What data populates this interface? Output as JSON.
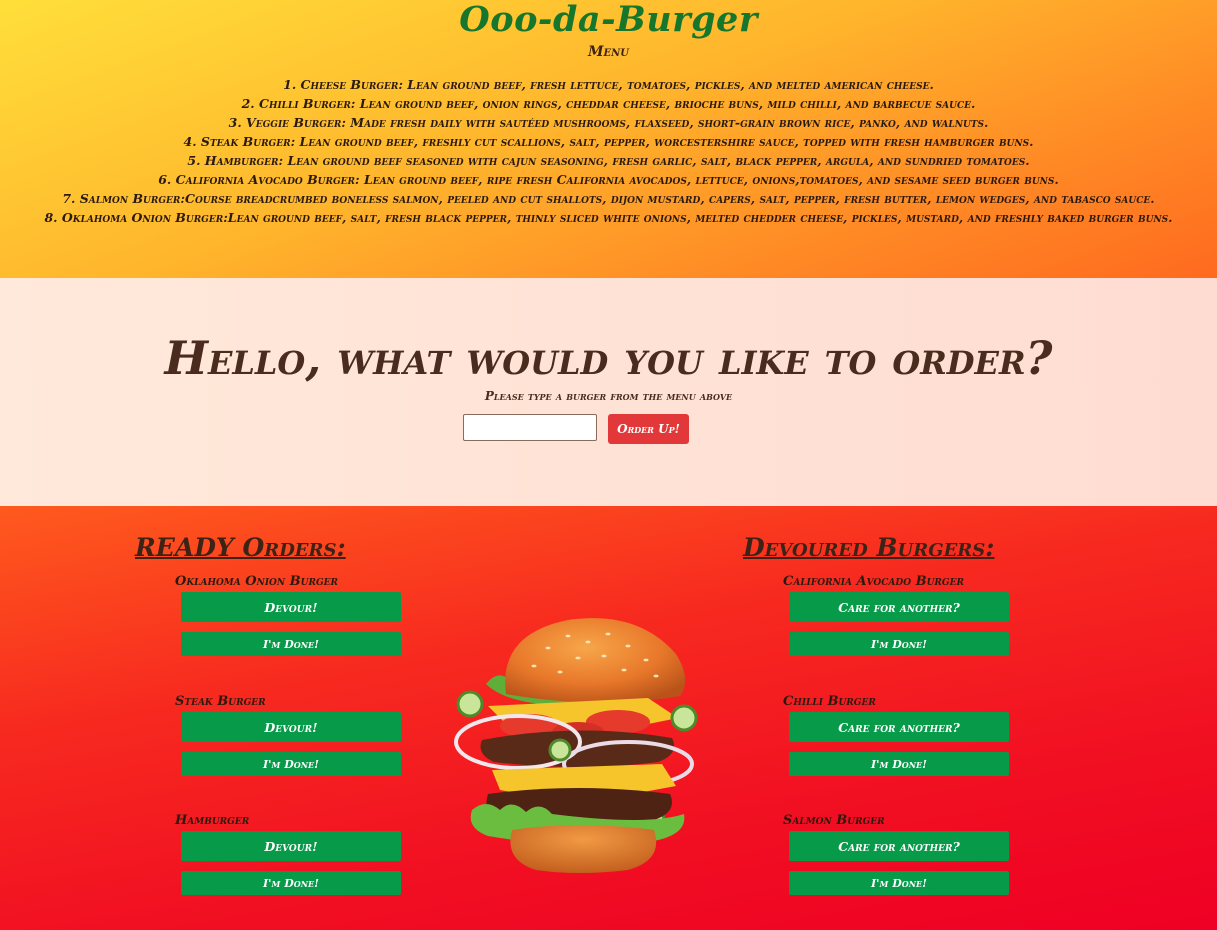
{
  "header": {
    "title": "Ooo-da-Burger",
    "menu_heading": "Menu",
    "menu_items": [
      "1. Cheese Burger: Lean ground beef, fresh lettuce, tomatoes, pickles, and melted american cheese.",
      "2. Chilli Burger: Lean ground beef, onion rings, cheddar cheese, brioche buns, mild chilli, and barbecue sauce.",
      "3. Veggie Burger: Made fresh daily with sautéed mushrooms, flaxseed, short-grain brown rice, panko, and walnuts.",
      "4. Steak Burger: Lean ground beef, freshly cut scallions, salt, pepper, worcestershire sauce, topped with fresh hamburger buns.",
      "5. Hamburger: Lean ground beef seasoned with cajun seasoning, fresh garlic, salt, black pepper, argula, and sundried tomatoes.",
      "6. California Avocado Burger: Lean ground beef, ripe fresh California avocados, lettuce, onions,tomatoes, and sesame seed burger buns.",
      "7. Salmon Burger:Course breadcrumbed boneless salmon, peeled and cut shallots, dijon mustard, capers, salt, pepper, fresh butter, lemon wedges, and tabasco sauce.",
      "8. Oklahoma Onion Burger:Lean ground beef, salt, fresh black pepper, thinly sliced white onions, melted chedder cheese, pickles, mustard, and freshly baked burger buns."
    ]
  },
  "order": {
    "question": "Hello, what would you like to order?",
    "hint": "Please type a burger from the menu above",
    "input_value": "",
    "button_label": "Order Up!"
  },
  "ready": {
    "heading": "READY Orders:",
    "items": [
      {
        "name": "Oklahoma Onion Burger",
        "primary": "Devour!",
        "secondary": "I'm Done!"
      },
      {
        "name": "Steak Burger",
        "primary": "Devour!",
        "secondary": "I'm Done!"
      },
      {
        "name": "Hamburger",
        "primary": "Devour!",
        "secondary": "I'm Done!"
      }
    ]
  },
  "devoured": {
    "heading": "Devoured Burgers:",
    "items": [
      {
        "name": "California Avocado Burger",
        "primary": "Care for another?",
        "secondary": "I'm Done!"
      },
      {
        "name": "Chilli Burger",
        "primary": "Care for another?",
        "secondary": "I'm Done!"
      },
      {
        "name": "Salmon Burger",
        "primary": "Care for another?",
        "secondary": "I'm Done!"
      }
    ]
  },
  "colors": {
    "title_green": "#15762c",
    "button_green": "#069a49",
    "order_button_red": "#e2383a",
    "text_brown": "#3d2316"
  },
  "images": {
    "center_illustration": "burger-illustration"
  }
}
